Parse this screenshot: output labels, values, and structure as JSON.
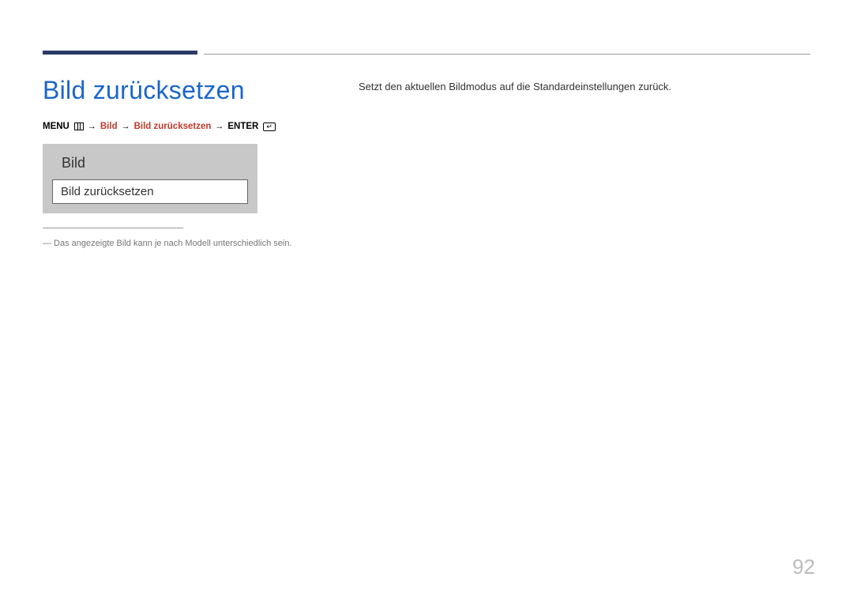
{
  "heading": "Bild zurücksetzen",
  "breadcrumb": {
    "menu_label": "MENU",
    "item1": "Bild",
    "item2": "Bild zurücksetzen",
    "enter_label": "ENTER",
    "arrow": "→"
  },
  "menu_box": {
    "title": "Bild",
    "item": "Bild zurücksetzen"
  },
  "footnote": "―  Das angezeigte Bild kann je nach Modell unterschiedlich sein.",
  "description": "Setzt den aktuellen Bildmodus auf die Standardeinstellungen zurück.",
  "page_number": "92"
}
